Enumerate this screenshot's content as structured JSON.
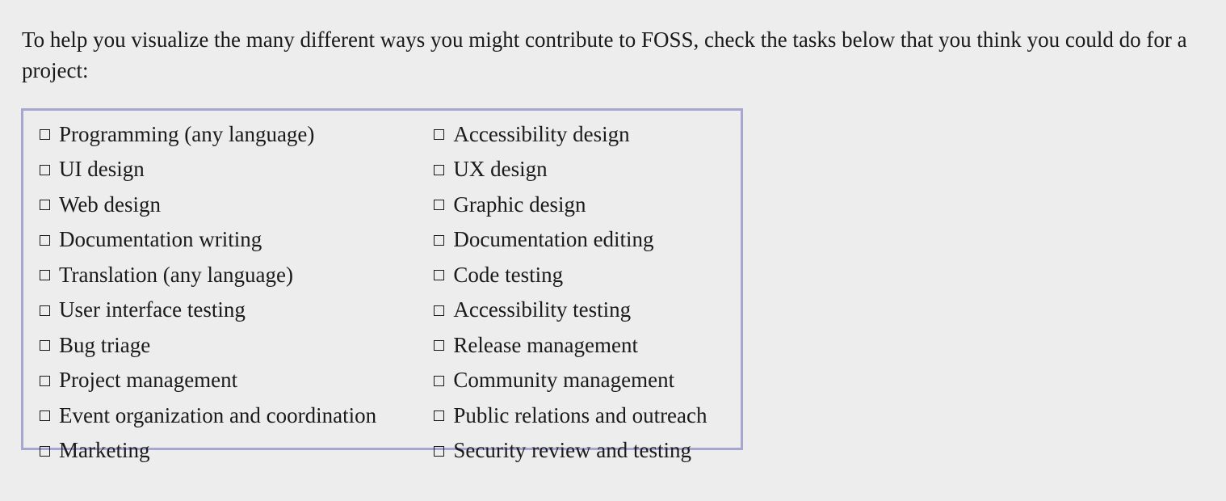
{
  "intro_text": "To help you visualize the many different ways you might contribute to FOSS, check the tasks below that you think you could do for a project:",
  "checkbox_glyph": "ballot-box-unchecked",
  "tasks": [
    [
      "Programming (any language)",
      "Accessibility design"
    ],
    [
      "UI design",
      "UX design"
    ],
    [
      "Web design",
      "Graphic design"
    ],
    [
      "Documentation writing",
      "Documentation editing"
    ],
    [
      "Translation (any language)",
      "Code testing"
    ],
    [
      "User interface testing",
      "Accessibility testing"
    ],
    [
      "Bug triage",
      "Release management"
    ],
    [
      "Project management",
      "Community management"
    ],
    [
      "Event organization and coordination",
      "Public relations and outreach"
    ],
    [
      "Marketing",
      "Security review and testing"
    ]
  ],
  "colors": {
    "background": "#ededed",
    "box_border": "#a6a6d0",
    "text": "#1a1a1a"
  }
}
